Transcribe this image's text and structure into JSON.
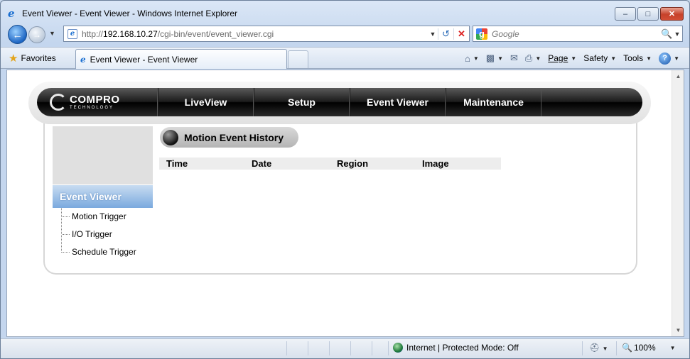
{
  "window": {
    "title": "Event Viewer - Event Viewer - Windows Internet Explorer",
    "minimize": "–",
    "maximize": "□",
    "close": "✕"
  },
  "address_bar": {
    "url_prefix": "http://",
    "url_host": "192.168.10.27",
    "url_path": "/cgi-bin/event/event_viewer.cgi"
  },
  "search": {
    "placeholder": "Google"
  },
  "favorites_bar": {
    "favorites_label": "Favorites",
    "tab_title": "Event Viewer - Event Viewer"
  },
  "command_bar": {
    "page": "Page",
    "safety": "Safety",
    "tools": "Tools",
    "help": "?"
  },
  "site": {
    "brand_main": "COMPRO",
    "brand_sub": "TECHNOLOGY",
    "nav": [
      "LiveView",
      "Setup",
      "Event Viewer",
      "Maintenance"
    ],
    "sidebar": {
      "header": "Event Viewer",
      "links": [
        "Motion Trigger",
        "I/O Trigger",
        "Schedule Trigger"
      ]
    },
    "panel_title": "Motion Event History",
    "table_columns": [
      "Time",
      "Date",
      "Region",
      "Image"
    ]
  },
  "status_bar": {
    "zone": "Internet | Protected Mode: Off",
    "zoom": "100%"
  },
  "colors": {
    "sidebar_header": "#7aa9de",
    "navbar": "#1b1b1b"
  },
  "icons": {
    "back": "arrow-left",
    "forward": "arrow-right",
    "refresh": "refresh",
    "stop": "stop",
    "search": "magnifier",
    "home": "home",
    "feeds": "rss",
    "mail": "mail",
    "print": "printer"
  }
}
